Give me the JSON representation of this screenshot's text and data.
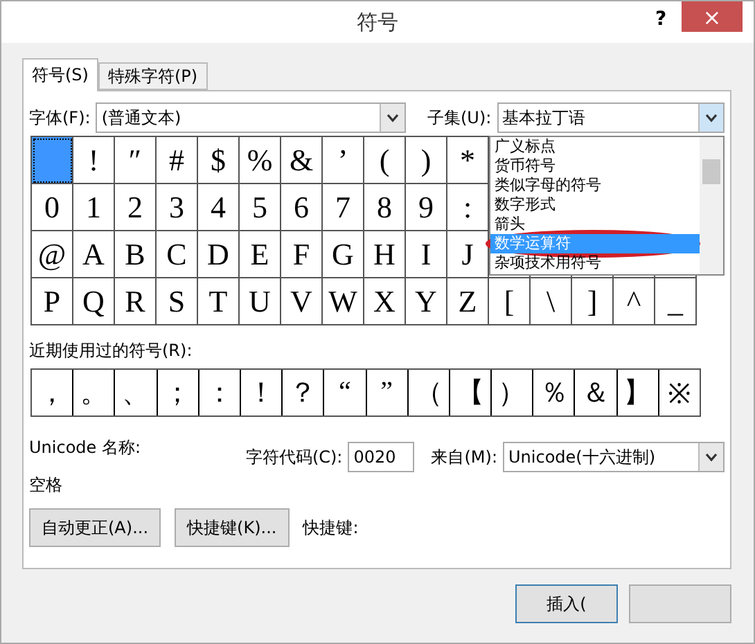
{
  "window": {
    "title": "符号",
    "help": "?",
    "close": "×"
  },
  "tabs": [
    {
      "label": "符号(S)",
      "selected": true
    },
    {
      "label": "特殊字符(P)",
      "selected": false
    }
  ],
  "font": {
    "label": "字体(F):",
    "value": "(普通文本)"
  },
  "subset": {
    "label": "子集(U):",
    "value": "基本拉丁语",
    "expanded": true,
    "options": [
      {
        "label": "广义标点",
        "selected": false
      },
      {
        "label": "货币符号",
        "selected": false
      },
      {
        "label": "类似字母的符号",
        "selected": false
      },
      {
        "label": "数字形式",
        "selected": false
      },
      {
        "label": "箭头",
        "selected": false
      },
      {
        "label": "数学运算符",
        "selected": true
      },
      {
        "label": "杂项技术用符号",
        "selected": false
      }
    ]
  },
  "symbol_grid": [
    {
      "cells": [
        {
          "selected": true
        },
        {
          "char": "!",
          "selected": false
        },
        {
          "char": "″",
          "selected": false
        },
        {
          "char": "#",
          "selected": false
        },
        {
          "char": "$",
          "selected": false
        },
        {
          "char": "%",
          "selected": false
        },
        {
          "char": "&",
          "selected": false
        },
        {
          "char": "’",
          "selected": false
        },
        {
          "char": "(",
          "selected": false
        },
        {
          "char": ")",
          "selected": false
        },
        {
          "char": "*",
          "selected": false
        }
      ]
    },
    {
      "cells": [
        {
          "char": "0",
          "selected": false
        },
        {
          "char": "1",
          "selected": false
        },
        {
          "char": "2",
          "selected": false
        },
        {
          "char": "3",
          "selected": false
        },
        {
          "char": "4",
          "selected": false
        },
        {
          "char": "5",
          "selected": false
        },
        {
          "char": "6",
          "selected": false
        },
        {
          "char": "7",
          "selected": false
        },
        {
          "char": "8",
          "selected": false
        },
        {
          "char": "9",
          "selected": false
        },
        {
          "char": ":",
          "selected": false
        }
      ]
    },
    {
      "cells": [
        {
          "char": "@",
          "selected": false
        },
        {
          "char": "A",
          "selected": false
        },
        {
          "char": "B",
          "selected": false
        },
        {
          "char": "C",
          "selected": false
        },
        {
          "char": "D",
          "selected": false
        },
        {
          "char": "E",
          "selected": false
        },
        {
          "char": "F",
          "selected": false
        },
        {
          "char": "G",
          "selected": false
        },
        {
          "char": "H",
          "selected": false
        },
        {
          "char": "I",
          "selected": false
        },
        {
          "char": "J",
          "selected": false
        }
      ]
    },
    {
      "cells": [
        {
          "char": "P",
          "selected": false
        },
        {
          "char": "Q",
          "selected": false
        },
        {
          "char": "R",
          "selected": false
        },
        {
          "char": "S",
          "selected": false
        },
        {
          "char": "T",
          "selected": false
        },
        {
          "char": "U",
          "selected": false
        },
        {
          "char": "V",
          "selected": false
        },
        {
          "char": "W",
          "selected": false
        },
        {
          "char": "X",
          "selected": false
        },
        {
          "char": "Y",
          "selected": false
        },
        {
          "char": "Z",
          "selected": false
        },
        {
          "char": "[",
          "selected": false
        },
        {
          "char": "\\",
          "selected": false
        },
        {
          "char": "]",
          "selected": false
        },
        {
          "char": "^",
          "selected": false
        },
        {
          "char": "_",
          "selected": false
        }
      ]
    }
  ],
  "recent": {
    "label": "近期使用过的符号(R):",
    "symbols": [
      "，",
      "。",
      "、",
      "；",
      "：",
      "！",
      "？",
      "“",
      "”",
      "（",
      "【",
      "）",
      "％",
      "＆",
      "】",
      "※"
    ]
  },
  "unicode_name": {
    "label": "Unicode 名称:",
    "value": "空格"
  },
  "char_code": {
    "label": "字符代码(C):",
    "value": "0020"
  },
  "from": {
    "label": "来自(M):",
    "value": "Unicode(十六进制)"
  },
  "buttons": [
    "自动更正(A)...",
    "快捷键(K)..."
  ],
  "shortcut": {
    "label": "快捷键:"
  },
  "footer_buttons": [
    "插入("
  ]
}
